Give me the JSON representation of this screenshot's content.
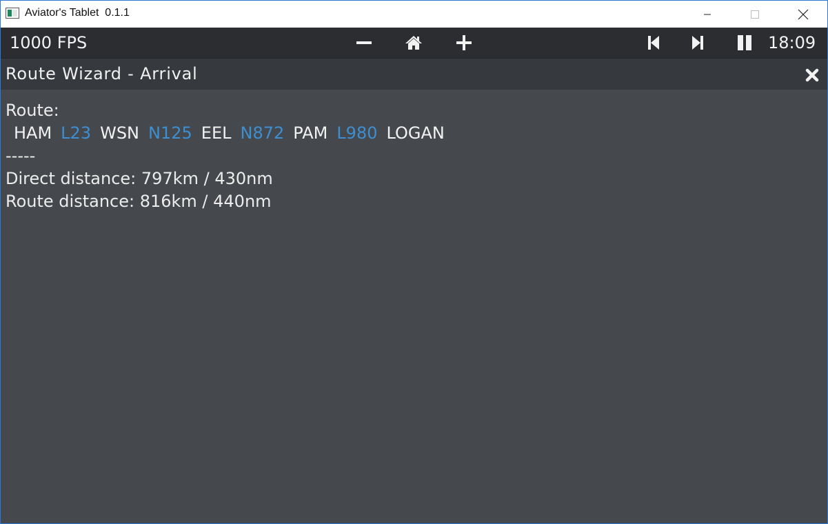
{
  "window": {
    "title": "Aviator's Tablet  0.1.1"
  },
  "toolbar": {
    "fps": "1000 FPS",
    "clock": "18:09",
    "icons": [
      "minus-icon",
      "home-icon",
      "plus-icon",
      "skip-back-icon",
      "skip-forward-icon",
      "pause-icon"
    ]
  },
  "page": {
    "title": "Route Wizard - Arrival"
  },
  "content": {
    "route_label": "Route:",
    "route": [
      {
        "text": "HAM",
        "kind": "waypoint"
      },
      {
        "text": "L23",
        "kind": "airway"
      },
      {
        "text": "WSN",
        "kind": "waypoint"
      },
      {
        "text": "N125",
        "kind": "airway"
      },
      {
        "text": "EEL",
        "kind": "waypoint"
      },
      {
        "text": "N872",
        "kind": "airway"
      },
      {
        "text": "PAM",
        "kind": "waypoint"
      },
      {
        "text": "L980",
        "kind": "airway"
      },
      {
        "text": "LOGAN",
        "kind": "waypoint"
      }
    ],
    "separator": "-----",
    "direct_distance": "Direct distance: 797km / 430nm",
    "route_distance": "Route distance: 816km / 440nm"
  },
  "colors": {
    "background": "#45484c",
    "toolbar": "#2b2d30",
    "header": "#36393d",
    "airway": "#3d8fd1",
    "text": "#ececec"
  }
}
